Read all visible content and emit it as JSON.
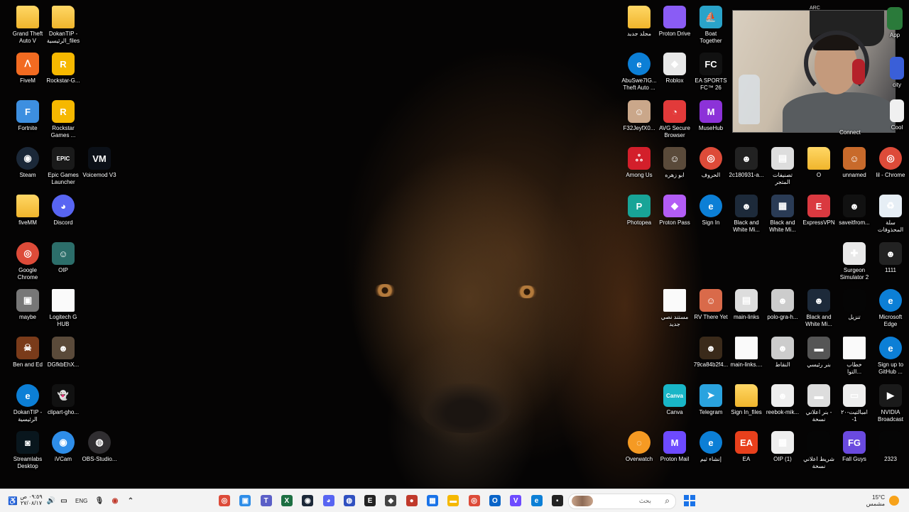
{
  "desktop": {
    "left_icons": [
      {
        "label": "Grand Theft\nAuto V",
        "glyph": "",
        "color": "#f5c542"
      },
      {
        "label": "DokanTIP -\nالرئيسية_files",
        "glyph": "",
        "color": "#f5c542"
      },
      {
        "label": "FiveM",
        "glyph": "ᐱ",
        "color": "#f26b21"
      },
      {
        "label": "Rockstar-G...",
        "glyph": "R",
        "color": "#f6b800"
      },
      {
        "label": "Fortnite",
        "glyph": "F",
        "color": "#3d8fe0"
      },
      {
        "label": "Rockstar\nGames ...",
        "glyph": "R",
        "color": "#f6b800"
      },
      {
        "label": "Steam",
        "glyph": "◉",
        "color": "#1b2838"
      },
      {
        "label": "Epic Games\nLauncher",
        "glyph": "EPIC",
        "color": "#1a1a1a"
      },
      {
        "label": "Voicemod V3",
        "glyph": "VM",
        "color": "#0b1018"
      },
      {
        "label": "fiveMM",
        "glyph": "",
        "color": "#f5c542"
      },
      {
        "label": "Discord",
        "glyph": "◕",
        "color": "#5865f2"
      },
      {
        "label": "Google\nChrome",
        "glyph": "◎",
        "color": "#dd4b39"
      },
      {
        "label": "OIP",
        "glyph": "☺",
        "color": "#2c6e6a"
      },
      {
        "label": "maybe",
        "glyph": "▣",
        "color": "#777"
      },
      {
        "label": "Logitech G\nHUB",
        "glyph": "",
        "color": "#fafafa"
      },
      {
        "label": "Ben and Ed",
        "glyph": "☠",
        "color": "#7a3b1a"
      },
      {
        "label": "DGfkbEhX...",
        "glyph": "☻",
        "color": "#5a4a3a"
      },
      {
        "label": "DokanTIP -\nالرئيسية",
        "glyph": "e",
        "color": "#0c7fd6"
      },
      {
        "label": "clipart-gho...",
        "glyph": "👻",
        "color": "#111"
      },
      {
        "label": "Streamlabs\nDesktop",
        "glyph": "◙",
        "color": "#09161d"
      },
      {
        "label": "iVCam",
        "glyph": "◉",
        "color": "#2e8de8"
      },
      {
        "label": "OBS-Studio...",
        "glyph": "◍",
        "color": "#302e31"
      }
    ],
    "right_icons": [
      {
        "label": "مجلد جديد",
        "glyph": "",
        "color": "#f5c542"
      },
      {
        "label": "Proton Drive",
        "glyph": "",
        "color": "#8a5cf5"
      },
      {
        "label": "Boat\nTogether",
        "glyph": "⛵",
        "color": "#2aa3c9"
      },
      {
        "label": "AbuSwe7IG...\nTheft Auto ...",
        "glyph": "e",
        "color": "#0c7fd6"
      },
      {
        "label": "Roblox",
        "glyph": "◆",
        "color": "#e8e8e8"
      },
      {
        "label": "EA SPORTS\nFC™ 26",
        "glyph": "FC",
        "color": "#111"
      },
      {
        "label": "F32JeyfX0...",
        "glyph": "☺",
        "color": "#caa78a"
      },
      {
        "label": "AVG Secure\nBrowser",
        "glyph": "◔",
        "color": "#e23a3a"
      },
      {
        "label": "MuseHub",
        "glyph": "M",
        "color": "#8c32d8"
      },
      {
        "label": "Among Us",
        "glyph": "ஃ",
        "color": "#d31f2b"
      },
      {
        "label": "ابو زهره",
        "glyph": "☺",
        "color": "#5a4a3a"
      },
      {
        "label": "الحروف",
        "glyph": "◎",
        "color": "#dd4b39"
      },
      {
        "label": "2c180931-a...",
        "glyph": "☻",
        "color": "#222"
      },
      {
        "label": "تصنيفات\nالمتجر",
        "glyph": "▤",
        "color": "#ddd"
      },
      {
        "label": "O",
        "glyph": "",
        "color": "#f5c542"
      },
      {
        "label": "unnamed",
        "glyph": "☺",
        "color": "#c86a2b"
      },
      {
        "label": "lil - Chrome",
        "glyph": "◎",
        "color": "#dd4b39"
      },
      {
        "label": "Photopea",
        "glyph": "P",
        "color": "#18a497"
      },
      {
        "label": "Proton Pass",
        "glyph": "◆",
        "color": "#b35cf5"
      },
      {
        "label": "Sign In",
        "glyph": "e",
        "color": "#0c7fd6"
      },
      {
        "label": "Black and\nWhite Mi...",
        "glyph": "☻",
        "color": "#1d2a3a"
      },
      {
        "label": "Black and\nWhite Mi...",
        "glyph": "▦",
        "color": "#2a3b55"
      },
      {
        "label": "ExpressVPN",
        "glyph": "E",
        "color": "#da3940"
      },
      {
        "label": "saveitfrom...",
        "glyph": "☻",
        "color": "#111"
      },
      {
        "label": "سلة\nالمحذوفات",
        "glyph": "♻",
        "color": "#e6eef5"
      },
      {
        "label": "Surgeon\nSimulator 2",
        "glyph": "✚",
        "color": "#e9e9e9"
      },
      {
        "label": "1111",
        "glyph": "☻",
        "color": "#222"
      },
      {
        "label": "مستند نصي\nجديد",
        "glyph": "",
        "color": "#fafafa"
      },
      {
        "label": "RV There Yet",
        "glyph": "☺",
        "color": "#d96a4a"
      },
      {
        "label": "main-links",
        "glyph": "▤",
        "color": "#ddd"
      },
      {
        "label": "polo-gra-h...",
        "glyph": "☻",
        "color": "#ccc"
      },
      {
        "label": "Black and\nWhite Mi...",
        "glyph": "☻",
        "color": "#1d2a3a"
      },
      {
        "label": "تنزيل",
        "glyph": "",
        "color": "#050505"
      },
      {
        "label": "Microsoft\nEdge",
        "glyph": "e",
        "color": "#0c7fd6"
      },
      {
        "label": "79ca84b2f4...",
        "glyph": "☻",
        "color": "#3a2a1a"
      },
      {
        "label": "main-links....",
        "glyph": "",
        "color": "#fafafa"
      },
      {
        "label": "النقاط",
        "glyph": "☻",
        "color": "#ccc"
      },
      {
        "label": "بنر رئيسي",
        "glyph": "▬",
        "color": "#555"
      },
      {
        "label": "خطاب\nالتوا...",
        "glyph": "",
        "color": "#fafafa"
      },
      {
        "label": "Sign up to\nGitHub ...",
        "glyph": "e",
        "color": "#0c7fd6"
      },
      {
        "label": "Canva",
        "glyph": "Canva",
        "color": "#19b6c7"
      },
      {
        "label": "Telegram",
        "glyph": "➤",
        "color": "#2aa3df"
      },
      {
        "label": "Sign In_files",
        "glyph": "",
        "color": "#f5c542"
      },
      {
        "label": "reebok-mik...",
        "glyph": "☻",
        "color": "#eee"
      },
      {
        "label": "بنر اعلاني -\nنسخة",
        "glyph": "▬",
        "color": "#ddd"
      },
      {
        "label": "امبالتيت-۲۰\n-1",
        "glyph": "▭",
        "color": "#eee"
      },
      {
        "label": "NVIDIA\nBroadcast",
        "glyph": "▶",
        "color": "#1a1a1a"
      },
      {
        "label": "Overwatch",
        "glyph": "◌",
        "color": "#f59a23"
      },
      {
        "label": "Proton Mail",
        "glyph": "M",
        "color": "#6d4aff"
      },
      {
        "label": "إنشاء ثيم",
        "glyph": "e",
        "color": "#0c7fd6"
      },
      {
        "label": "EA",
        "glyph": "EA",
        "color": "#e8401c"
      },
      {
        "label": "OIP (1)",
        "glyph": "▦",
        "color": "#eee"
      },
      {
        "label": "شريط اعلاني\nنسخة",
        "glyph": "",
        "color": "#050505"
      },
      {
        "label": "Fall Guys",
        "glyph": "FG",
        "color": "#6a4adf"
      },
      {
        "label": "2323",
        "glyph": "",
        "color": "#050505"
      }
    ],
    "partial_labels": {
      "app": "App",
      "city": "city",
      "cool": "Cool",
      "connect": "Connect",
      "arc": "ARC"
    }
  },
  "taskbar": {
    "clock_time": "٠٩:٥٩ ص",
    "clock_date": "٢٧/٠٨/١٧",
    "language": "ENG",
    "search_placeholder": "بحث",
    "weather_temp": "15°C",
    "weather_desc": "مشمس",
    "pinned_apps": [
      {
        "name": "chrome-icon",
        "glyph": "◎",
        "color": "#dd4b39"
      },
      {
        "name": "app-icon",
        "glyph": "▣",
        "color": "#2e8de8"
      },
      {
        "name": "teams-icon",
        "glyph": "T",
        "color": "#5b5fc7"
      },
      {
        "name": "excel-icon",
        "glyph": "X",
        "color": "#1d6f42"
      },
      {
        "name": "steam-icon",
        "glyph": "◉",
        "color": "#1b2838"
      },
      {
        "name": "discord-icon",
        "glyph": "◕",
        "color": "#5865f2"
      },
      {
        "name": "headset-icon",
        "glyph": "◍",
        "color": "#3050c0"
      },
      {
        "name": "epic-icon",
        "glyph": "E",
        "color": "#222"
      },
      {
        "name": "unity-icon",
        "glyph": "◆",
        "color": "#444"
      },
      {
        "name": "recorder-icon",
        "glyph": "●",
        "color": "#c0392b"
      },
      {
        "name": "store-icon",
        "glyph": "▦",
        "color": "#1a73e8"
      },
      {
        "name": "file-explorer-icon",
        "glyph": "▬",
        "color": "#f5b800"
      },
      {
        "name": "chrome-icon-2",
        "glyph": "◎",
        "color": "#dd4b39"
      },
      {
        "name": "outlook-icon",
        "glyph": "O",
        "color": "#0a64c8"
      },
      {
        "name": "proton-vpn-icon",
        "glyph": "V",
        "color": "#6d4aff"
      },
      {
        "name": "edge-icon",
        "glyph": "e",
        "color": "#0c7fd6"
      },
      {
        "name": "terminal-icon",
        "glyph": "▪",
        "color": "#222"
      }
    ]
  }
}
